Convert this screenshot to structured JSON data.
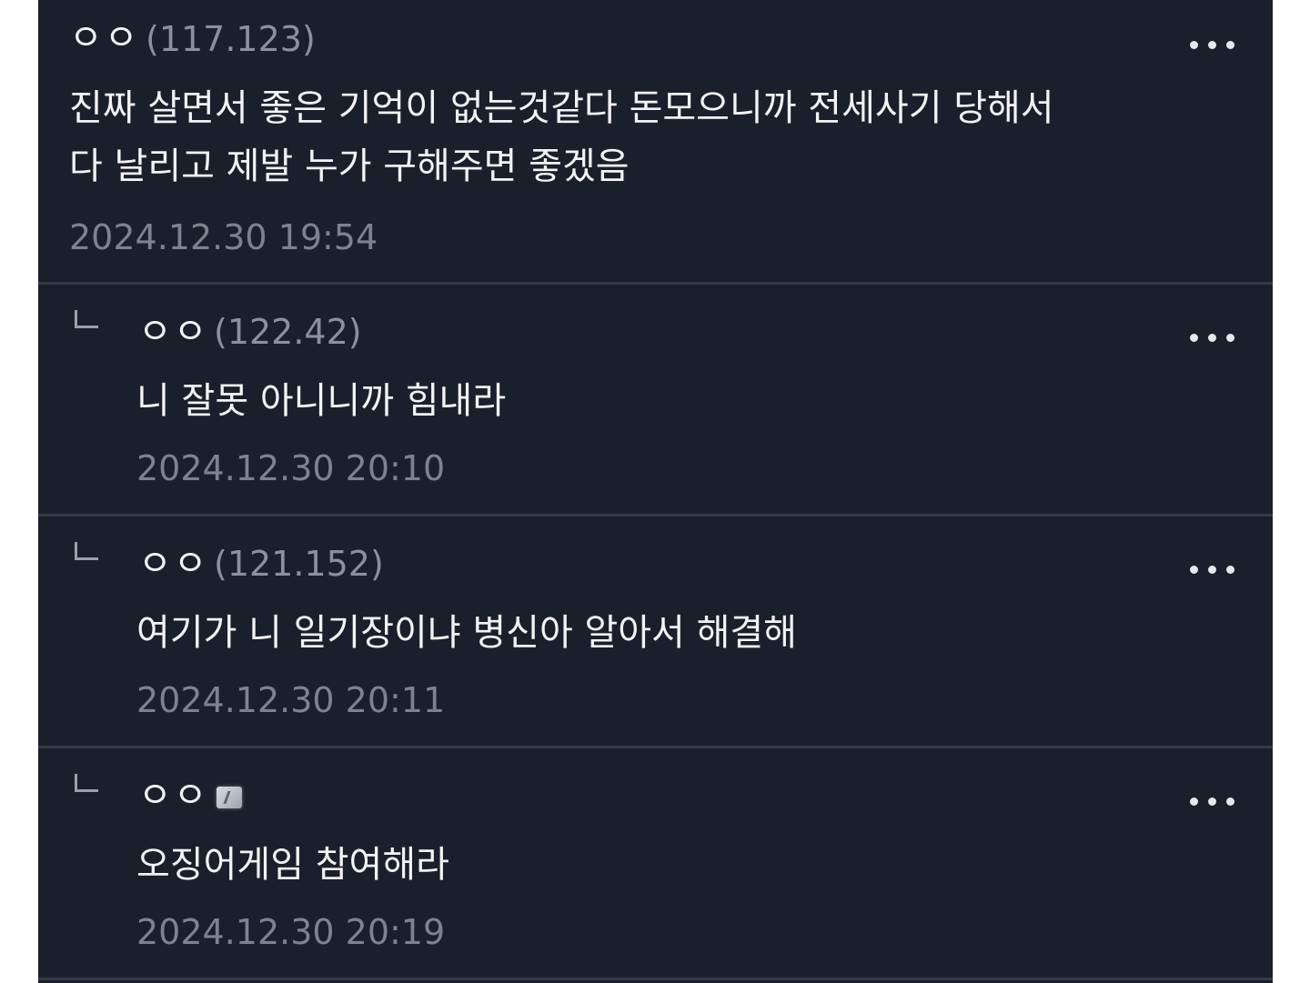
{
  "colors": {
    "background": "#1a202b",
    "divider": "#333a47",
    "text": "#f2f3f5",
    "meta_text": "#8b919c"
  },
  "comments": [
    {
      "nickname": "ㅇㅇ",
      "ip": "(117.123)",
      "text_lines": [
        "진짜 살면서 좋은 기억이 없는것같다 돈모으니까 전세사기 당해서",
        "다 날리고 제발 누가 구해주면 좋겠음"
      ],
      "datetime": "2024.12.30 19:54",
      "is_reply": false,
      "more_icon": "more-horizontal-icon"
    },
    {
      "nickname": "ㅇㅇ",
      "ip": "(122.42)",
      "text_lines": [
        "니 잘못 아니니까 힘내라"
      ],
      "datetime": "2024.12.30 20:10",
      "is_reply": true,
      "more_icon": "more-horizontal-icon"
    },
    {
      "nickname": "ㅇㅇ",
      "ip": "(121.152)",
      "text_lines": [
        "여기가 니 일기장이냐 병신아 알아서 해결해"
      ],
      "datetime": "2024.12.30 20:11",
      "is_reply": true,
      "more_icon": "more-horizontal-icon"
    },
    {
      "nickname": "ㅇㅇ",
      "ip": "",
      "badge_icon": "member-badge-icon",
      "text_lines": [
        "오징어게임 참여해라"
      ],
      "datetime": "2024.12.30 20:19",
      "is_reply": true,
      "more_icon": "more-horizontal-icon"
    }
  ]
}
